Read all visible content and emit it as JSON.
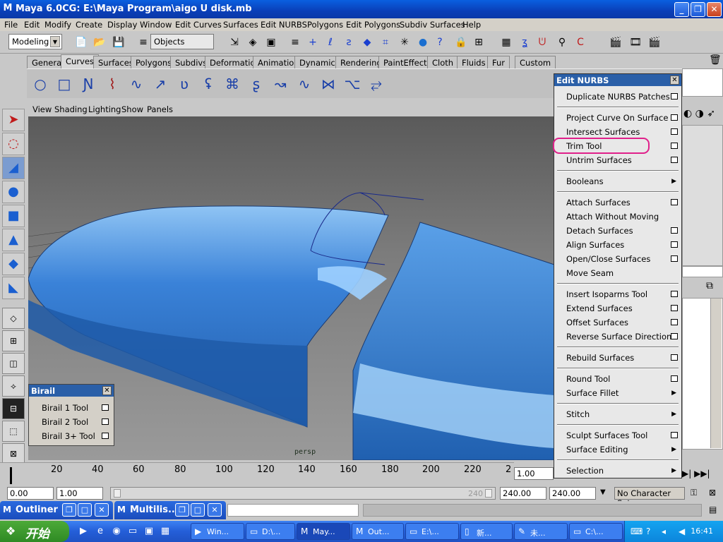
{
  "window": {
    "title": "Maya 6.0CG: E:\\Maya Program\\aigo U disk.mb"
  },
  "menubar": [
    "File",
    "Edit",
    "Modify",
    "Create",
    "Display",
    "Window",
    "Edit Curves",
    "Surfaces",
    "Edit NURBS",
    "Polygons",
    "Edit Polygons",
    "Subdiv Surfaces",
    "Help"
  ],
  "statusline": {
    "mode": "Modeling",
    "selection_field": "Objects"
  },
  "shelf_tabs": [
    {
      "label": "General",
      "active": false
    },
    {
      "label": "Curves",
      "active": true
    },
    {
      "label": "Surfaces",
      "active": false
    },
    {
      "label": "Polygons",
      "active": false
    },
    {
      "label": "Subdivs",
      "active": false
    },
    {
      "label": "Deformation",
      "active": false
    },
    {
      "label": "Animation",
      "active": false
    },
    {
      "label": "Dynamics",
      "active": false
    },
    {
      "label": "Rendering",
      "active": false
    },
    {
      "label": "PaintEffects",
      "active": false
    },
    {
      "label": "Cloth",
      "active": false
    },
    {
      "label": "Fluids",
      "active": false
    },
    {
      "label": "Fur",
      "active": false
    },
    {
      "label": "Custom",
      "active": false
    }
  ],
  "panel_menu": [
    "View",
    "Shading",
    "Lighting",
    "Show",
    "Panels"
  ],
  "viewport": {
    "camera": "persp"
  },
  "birail_window": {
    "title": "Birail",
    "items": [
      "Birail 1 Tool",
      "Birail 2 Tool",
      "Birail 3+ Tool"
    ]
  },
  "edit_nurbs_menu": {
    "title": "Edit NURBS",
    "items": [
      {
        "label": "Duplicate NURBS Patches",
        "option": true
      },
      {
        "label": "Project Curve On Surface",
        "option": true
      },
      {
        "label": "Intersect Surfaces",
        "option": true
      },
      {
        "label": "Trim Tool",
        "option": true
      },
      {
        "label": "Untrim Surfaces",
        "option": true
      },
      {
        "label": "Booleans",
        "submenu": true
      },
      {
        "label": "Attach Surfaces",
        "option": true
      },
      {
        "label": "Attach Without Moving"
      },
      {
        "label": "Detach Surfaces",
        "option": true
      },
      {
        "label": "Align Surfaces",
        "option": true
      },
      {
        "label": "Open/Close Surfaces",
        "option": true
      },
      {
        "label": "Move Seam"
      },
      {
        "label": "Insert Isoparms Tool",
        "option": true
      },
      {
        "label": "Extend Surfaces",
        "option": true
      },
      {
        "label": "Offset Surfaces",
        "option": true
      },
      {
        "label": "Reverse Surface Direction",
        "option": true
      },
      {
        "label": "Rebuild Surfaces",
        "option": true
      },
      {
        "label": "Round Tool",
        "option": true
      },
      {
        "label": "Surface Fillet",
        "submenu": true
      },
      {
        "label": "Stitch",
        "submenu": true
      },
      {
        "label": "Sculpt Surfaces Tool",
        "option": true
      },
      {
        "label": "Surface Editing",
        "submenu": true
      },
      {
        "label": "Selection",
        "submenu": true
      }
    ]
  },
  "timeslider": {
    "ticks": [
      "20",
      "40",
      "60",
      "80",
      "100",
      "120",
      "140",
      "160",
      "180",
      "200",
      "220",
      "2"
    ],
    "current_time": "1.00"
  },
  "range_slider": {
    "start": "0.00",
    "playback_start": "1.00",
    "range_end_label": "240",
    "playback_end": "240.00",
    "end": "240.00",
    "character_set": "No Character Set"
  },
  "dock_windows": [
    {
      "label": "Outliner"
    },
    {
      "label": "Multilis..."
    }
  ],
  "taskbar": {
    "start_label": "开始",
    "tasks": [
      {
        "label": "Win...",
        "active": false
      },
      {
        "label": "D:\\...",
        "active": false
      },
      {
        "label": "May...",
        "active": true
      },
      {
        "label": "Out...",
        "active": false
      },
      {
        "label": "E:\\...",
        "active": false
      },
      {
        "label": "新...",
        "active": false
      },
      {
        "label": "未...",
        "active": false
      },
      {
        "label": "C:\\...",
        "active": false
      }
    ],
    "clock": "16:41"
  },
  "colors": {
    "title_blue": "#0a3fb8",
    "surface_blue": "#3a82d8",
    "highlight_magenta": "#e0208a",
    "menu_header": "#2a5fa8"
  }
}
